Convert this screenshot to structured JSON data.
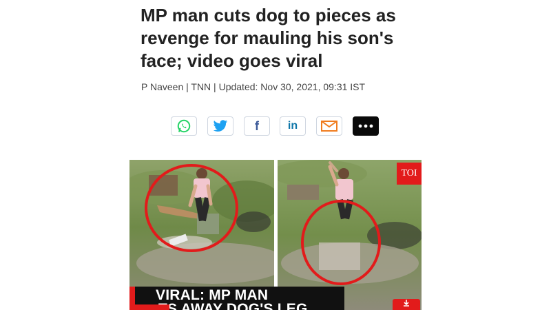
{
  "article": {
    "headline": "MP man cuts dog to pieces as revenge for mauling his son's face; video goes viral",
    "byline": "P Naveen | TNN | Updated: Nov 30, 2021, 09:31 IST"
  },
  "share": {
    "buttons": [
      {
        "name": "whatsapp",
        "icon": "whatsapp-icon",
        "color": "#25D366"
      },
      {
        "name": "twitter",
        "icon": "twitter-icon",
        "color": "#1DA1F2"
      },
      {
        "name": "facebook",
        "icon": "facebook-icon",
        "color": "#3b5998",
        "glyph": "f"
      },
      {
        "name": "linkedin",
        "icon": "linkedin-icon",
        "color": "#0e76a8",
        "glyph": "in"
      },
      {
        "name": "email",
        "icon": "mail-icon",
        "color": "#f07c1e"
      },
      {
        "name": "more",
        "icon": "more-icon",
        "color": "#000000"
      }
    ]
  },
  "media": {
    "watermark": "TOI",
    "caption_line1": "VIRAL: MP MAN",
    "caption_line2": "TS AWAY DOG'S LEG",
    "accent_color": "#e21b1b"
  }
}
